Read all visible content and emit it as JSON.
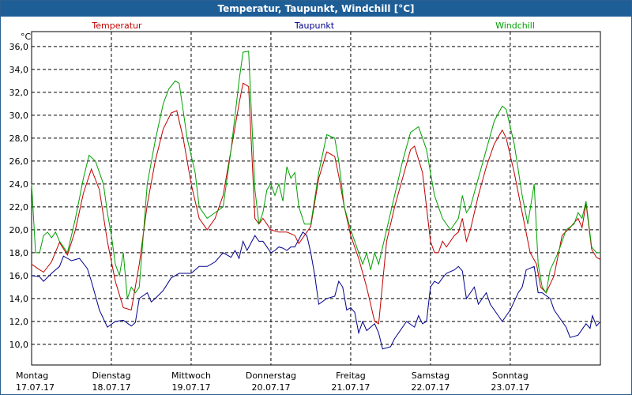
{
  "window": {
    "title": "Temperatur, Taupunkt, Windchill [°C]"
  },
  "chart_data": {
    "type": "line",
    "title": "Temperatur, Taupunkt, Windchill [°C]",
    "ylabel": "°C",
    "ylim": [
      8.2,
      37.3
    ],
    "xlim": [
      0,
      7.13
    ],
    "y_ticks": [
      "10,0",
      "12,0",
      "14,0",
      "16,0",
      "18,0",
      "20,0",
      "22,0",
      "24,0",
      "26,0",
      "28,0",
      "30,0",
      "32,0",
      "34,0",
      "36,0"
    ],
    "y_tick_values": [
      10,
      12,
      14,
      16,
      18,
      20,
      22,
      24,
      26,
      28,
      30,
      32,
      34,
      36
    ],
    "x_ticks": [
      {
        "day": "Montag",
        "date": "17.07.17"
      },
      {
        "day": "Dienstag",
        "date": "18.07.17"
      },
      {
        "day": "Mittwoch",
        "date": "19.07.17"
      },
      {
        "day": "Donnerstag",
        "date": "20.07.17"
      },
      {
        "day": "Freitag",
        "date": "21.07.17"
      },
      {
        "day": "Samstag",
        "date": "22.07.17"
      },
      {
        "day": "Sonntag",
        "date": "23.07.17"
      }
    ],
    "grid": true,
    "series": [
      {
        "name": "Temperatur",
        "color": "#c00000",
        "points": [
          [
            0,
            17.0
          ],
          [
            0.08,
            16.6
          ],
          [
            0.15,
            16.3
          ],
          [
            0.25,
            17.2
          ],
          [
            0.35,
            18.9
          ],
          [
            0.45,
            17.8
          ],
          [
            0.55,
            20.0
          ],
          [
            0.65,
            23.2
          ],
          [
            0.75,
            25.3
          ],
          [
            0.85,
            23.5
          ],
          [
            0.95,
            19.0
          ],
          [
            1.05,
            15.5
          ],
          [
            1.15,
            13.2
          ],
          [
            1.25,
            13.0
          ],
          [
            1.35,
            17.0
          ],
          [
            1.45,
            22.2
          ],
          [
            1.55,
            26.0
          ],
          [
            1.65,
            28.8
          ],
          [
            1.75,
            30.2
          ],
          [
            1.82,
            30.4
          ],
          [
            1.9,
            28.0
          ],
          [
            2.0,
            24.0
          ],
          [
            2.1,
            21.0
          ],
          [
            2.2,
            20.0
          ],
          [
            2.3,
            21.0
          ],
          [
            2.4,
            23.0
          ],
          [
            2.5,
            27.0
          ],
          [
            2.6,
            31.0
          ],
          [
            2.65,
            32.8
          ],
          [
            2.72,
            32.5
          ],
          [
            2.8,
            21.0
          ],
          [
            2.85,
            20.5
          ],
          [
            2.9,
            21.0
          ],
          [
            3.0,
            20.0
          ],
          [
            3.1,
            19.8
          ],
          [
            3.2,
            19.8
          ],
          [
            3.3,
            19.5
          ],
          [
            3.35,
            18.8
          ],
          [
            3.42,
            19.5
          ],
          [
            3.5,
            20.3
          ],
          [
            3.6,
            24.5
          ],
          [
            3.7,
            26.8
          ],
          [
            3.8,
            26.4
          ],
          [
            3.85,
            24.7
          ],
          [
            3.92,
            22.0
          ],
          [
            4.0,
            19.5
          ],
          [
            4.1,
            17.5
          ],
          [
            4.2,
            15.0
          ],
          [
            4.3,
            12.0
          ],
          [
            4.35,
            11.8
          ],
          [
            4.45,
            19.0
          ],
          [
            4.55,
            22.0
          ],
          [
            4.65,
            24.5
          ],
          [
            4.75,
            27.0
          ],
          [
            4.8,
            27.3
          ],
          [
            4.9,
            25.0
          ],
          [
            4.95,
            22.0
          ],
          [
            5.0,
            19.0
          ],
          [
            5.05,
            18.0
          ],
          [
            5.1,
            18.0
          ],
          [
            5.15,
            19.0
          ],
          [
            5.2,
            18.5
          ],
          [
            5.3,
            19.5
          ],
          [
            5.35,
            19.8
          ],
          [
            5.4,
            21.0
          ],
          [
            5.45,
            19.0
          ],
          [
            5.5,
            20.0
          ],
          [
            5.6,
            23.0
          ],
          [
            5.7,
            25.5
          ],
          [
            5.8,
            27.5
          ],
          [
            5.9,
            28.7
          ],
          [
            5.95,
            28.0
          ],
          [
            6.05,
            25.0
          ],
          [
            6.15,
            21.5
          ],
          [
            6.25,
            18.0
          ],
          [
            6.33,
            17.0
          ],
          [
            6.38,
            15.0
          ],
          [
            6.45,
            14.5
          ],
          [
            6.55,
            16.0
          ],
          [
            6.65,
            19.5
          ],
          [
            6.75,
            20.2
          ],
          [
            6.85,
            21.0
          ],
          [
            6.9,
            20.2
          ],
          [
            6.95,
            22.3
          ],
          [
            7.02,
            18.3
          ],
          [
            7.08,
            17.6
          ],
          [
            7.13,
            17.4
          ]
        ]
      },
      {
        "name": "Taupunkt",
        "color": "#00008b",
        "points": [
          [
            0,
            16.0
          ],
          [
            0.1,
            15.9
          ],
          [
            0.15,
            15.5
          ],
          [
            0.25,
            16.2
          ],
          [
            0.35,
            16.8
          ],
          [
            0.4,
            17.7
          ],
          [
            0.5,
            17.3
          ],
          [
            0.6,
            17.5
          ],
          [
            0.7,
            16.6
          ],
          [
            0.75,
            15.5
          ],
          [
            0.85,
            13.0
          ],
          [
            0.95,
            11.5
          ],
          [
            1.05,
            12.0
          ],
          [
            1.15,
            12.1
          ],
          [
            1.25,
            11.6
          ],
          [
            1.3,
            11.9
          ],
          [
            1.35,
            14.0
          ],
          [
            1.45,
            14.5
          ],
          [
            1.5,
            13.7
          ],
          [
            1.55,
            14.0
          ],
          [
            1.65,
            14.7
          ],
          [
            1.75,
            15.8
          ],
          [
            1.85,
            16.2
          ],
          [
            2.0,
            16.2
          ],
          [
            2.1,
            16.8
          ],
          [
            2.2,
            16.8
          ],
          [
            2.3,
            17.2
          ],
          [
            2.4,
            18.0
          ],
          [
            2.5,
            17.6
          ],
          [
            2.55,
            18.2
          ],
          [
            2.6,
            17.5
          ],
          [
            2.65,
            19.0
          ],
          [
            2.7,
            18.2
          ],
          [
            2.8,
            19.5
          ],
          [
            2.85,
            19.0
          ],
          [
            2.9,
            19.0
          ],
          [
            2.95,
            18.5
          ],
          [
            3.0,
            18.0
          ],
          [
            3.05,
            18.2
          ],
          [
            3.1,
            18.5
          ],
          [
            3.15,
            18.4
          ],
          [
            3.2,
            18.2
          ],
          [
            3.25,
            18.5
          ],
          [
            3.3,
            18.5
          ],
          [
            3.4,
            19.8
          ],
          [
            3.45,
            19.5
          ],
          [
            3.5,
            18.0
          ],
          [
            3.55,
            16.0
          ],
          [
            3.6,
            13.5
          ],
          [
            3.7,
            14.0
          ],
          [
            3.8,
            14.2
          ],
          [
            3.85,
            15.5
          ],
          [
            3.9,
            15.0
          ],
          [
            3.95,
            13.0
          ],
          [
            4.0,
            13.2
          ],
          [
            4.05,
            12.8
          ],
          [
            4.1,
            11.0
          ],
          [
            4.15,
            12.0
          ],
          [
            4.2,
            11.2
          ],
          [
            4.3,
            11.8
          ],
          [
            4.35,
            11.0
          ],
          [
            4.4,
            9.6
          ],
          [
            4.5,
            9.8
          ],
          [
            4.55,
            10.5
          ],
          [
            4.65,
            11.5
          ],
          [
            4.7,
            12.0
          ],
          [
            4.8,
            11.5
          ],
          [
            4.85,
            12.5
          ],
          [
            4.9,
            11.8
          ],
          [
            4.95,
            12.0
          ],
          [
            5.0,
            15.0
          ],
          [
            5.05,
            15.5
          ],
          [
            5.1,
            15.3
          ],
          [
            5.15,
            15.8
          ],
          [
            5.2,
            16.2
          ],
          [
            5.3,
            16.5
          ],
          [
            5.35,
            16.8
          ],
          [
            5.4,
            16.4
          ],
          [
            5.45,
            14.0
          ],
          [
            5.5,
            14.5
          ],
          [
            5.55,
            15.0
          ],
          [
            5.6,
            13.5
          ],
          [
            5.7,
            14.5
          ],
          [
            5.75,
            13.5
          ],
          [
            5.85,
            12.5
          ],
          [
            5.9,
            12.0
          ],
          [
            6.0,
            13.0
          ],
          [
            6.1,
            14.5
          ],
          [
            6.15,
            15.0
          ],
          [
            6.2,
            16.5
          ],
          [
            6.3,
            16.8
          ],
          [
            6.35,
            14.5
          ],
          [
            6.4,
            14.5
          ],
          [
            6.5,
            14.0
          ],
          [
            6.55,
            13.0
          ],
          [
            6.65,
            12.0
          ],
          [
            6.7,
            11.5
          ],
          [
            6.75,
            10.6
          ],
          [
            6.85,
            10.8
          ],
          [
            6.95,
            11.8
          ],
          [
            7.0,
            11.4
          ],
          [
            7.03,
            12.5
          ],
          [
            7.08,
            11.6
          ],
          [
            7.13,
            12.0
          ]
        ]
      },
      {
        "name": "Windchill",
        "color": "#00a000",
        "points": [
          [
            0,
            24.0
          ],
          [
            0.05,
            18.0
          ],
          [
            0.1,
            18.0
          ],
          [
            0.15,
            19.5
          ],
          [
            0.2,
            19.8
          ],
          [
            0.25,
            19.3
          ],
          [
            0.3,
            19.8
          ],
          [
            0.35,
            19.0
          ],
          [
            0.45,
            18.0
          ],
          [
            0.55,
            21.0
          ],
          [
            0.65,
            24.5
          ],
          [
            0.72,
            26.5
          ],
          [
            0.8,
            26.0
          ],
          [
            0.9,
            24.0
          ],
          [
            0.95,
            21.5
          ],
          [
            1.0,
            19.5
          ],
          [
            1.05,
            17.0
          ],
          [
            1.1,
            16.0
          ],
          [
            1.15,
            18.0
          ],
          [
            1.2,
            14.0
          ],
          [
            1.25,
            15.0
          ],
          [
            1.3,
            14.5
          ],
          [
            1.35,
            15.0
          ],
          [
            1.45,
            24.0
          ],
          [
            1.55,
            27.8
          ],
          [
            1.65,
            31.0
          ],
          [
            1.72,
            32.3
          ],
          [
            1.8,
            33.0
          ],
          [
            1.85,
            32.8
          ],
          [
            1.95,
            28.0
          ],
          [
            2.05,
            25.0
          ],
          [
            2.1,
            22.0
          ],
          [
            2.2,
            21.0
          ],
          [
            2.3,
            21.5
          ],
          [
            2.4,
            22.0
          ],
          [
            2.5,
            27.0
          ],
          [
            2.6,
            33.0
          ],
          [
            2.65,
            35.5
          ],
          [
            2.72,
            35.6
          ],
          [
            2.8,
            23.5
          ],
          [
            2.85,
            20.5
          ],
          [
            2.9,
            21.5
          ],
          [
            2.95,
            23.5
          ],
          [
            3.0,
            24.0
          ],
          [
            3.05,
            23.0
          ],
          [
            3.1,
            24.0
          ],
          [
            3.15,
            22.5
          ],
          [
            3.2,
            25.5
          ],
          [
            3.25,
            24.5
          ],
          [
            3.3,
            25.0
          ],
          [
            3.35,
            22.0
          ],
          [
            3.42,
            20.5
          ],
          [
            3.5,
            20.5
          ],
          [
            3.6,
            25.0
          ],
          [
            3.7,
            28.3
          ],
          [
            3.8,
            28.0
          ],
          [
            3.85,
            26.0
          ],
          [
            3.92,
            22.0
          ],
          [
            4.0,
            20.0
          ],
          [
            4.05,
            19.0
          ],
          [
            4.15,
            17.0
          ],
          [
            4.2,
            18.0
          ],
          [
            4.25,
            16.5
          ],
          [
            4.3,
            18.0
          ],
          [
            4.35,
            17.0
          ],
          [
            4.45,
            20.0
          ],
          [
            4.55,
            23.0
          ],
          [
            4.65,
            26.0
          ],
          [
            4.75,
            28.5
          ],
          [
            4.85,
            29.0
          ],
          [
            4.95,
            27.0
          ],
          [
            5.0,
            25.0
          ],
          [
            5.05,
            23.0
          ],
          [
            5.15,
            21.0
          ],
          [
            5.25,
            20.0
          ],
          [
            5.35,
            21.0
          ],
          [
            5.4,
            23.0
          ],
          [
            5.45,
            21.5
          ],
          [
            5.5,
            22.0
          ],
          [
            5.6,
            24.5
          ],
          [
            5.7,
            27.0
          ],
          [
            5.8,
            29.5
          ],
          [
            5.9,
            30.8
          ],
          [
            5.95,
            30.5
          ],
          [
            6.05,
            27.5
          ],
          [
            6.15,
            23.0
          ],
          [
            6.22,
            20.5
          ],
          [
            6.3,
            24.0
          ],
          [
            6.35,
            17.0
          ],
          [
            6.4,
            15.0
          ],
          [
            6.45,
            14.5
          ],
          [
            6.5,
            16.5
          ],
          [
            6.6,
            18.0
          ],
          [
            6.7,
            20.0
          ],
          [
            6.8,
            20.5
          ],
          [
            6.85,
            21.5
          ],
          [
            6.9,
            21.0
          ],
          [
            6.95,
            22.5
          ],
          [
            7.02,
            18.5
          ],
          [
            7.08,
            18.0
          ],
          [
            7.13,
            18.0
          ]
        ]
      }
    ]
  }
}
